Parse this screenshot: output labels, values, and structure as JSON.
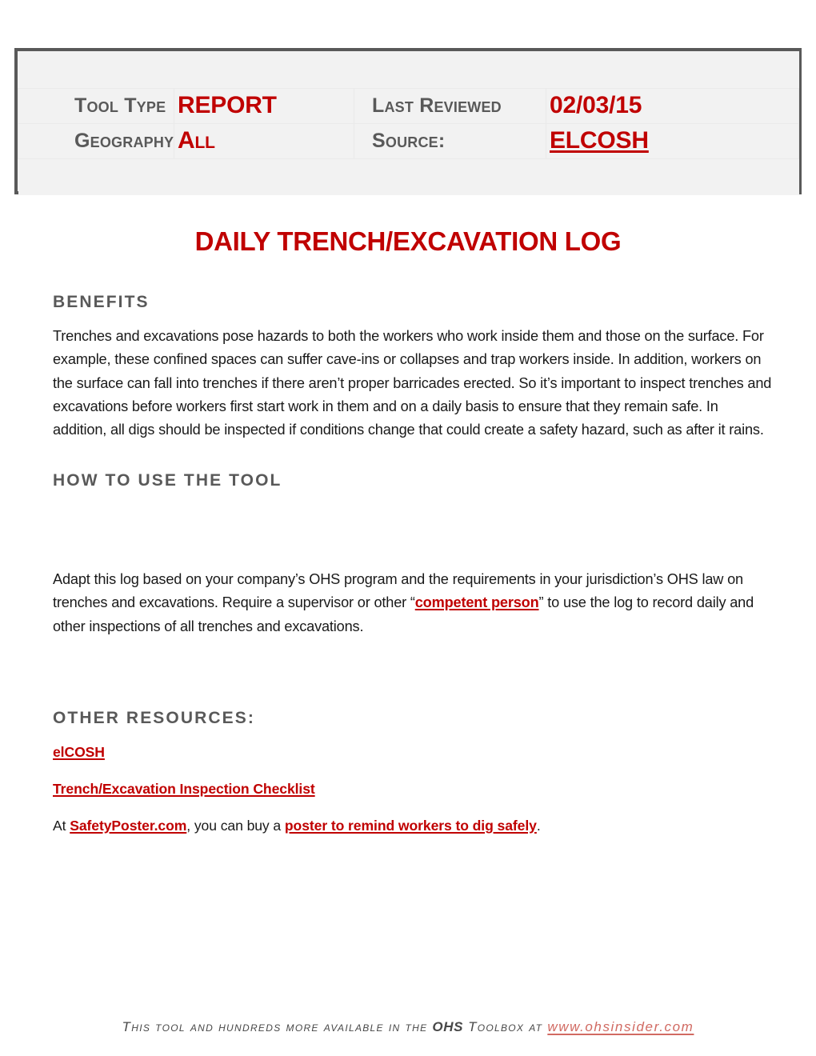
{
  "meta": {
    "rows": [
      {
        "label_left": "Tool Type",
        "value_left": "REPORT",
        "label_right": "Last Reviewed",
        "value_right": "02/03/15"
      },
      {
        "label_left": "Geography",
        "value_left": "All",
        "label_right": "Source:",
        "value_right": "ELCOSH"
      }
    ]
  },
  "title": "DAILY TRENCH/EXCAVATION LOG",
  "sections": {
    "benefits": {
      "heading": "BENEFITS",
      "body": "Trenches and excavations pose hazards to both the workers who work inside them and those on the surface. For example, these confined spaces can suffer cave-ins or collapses and trap workers inside. In addition, workers on the surface can fall into trenches if there aren’t proper barricades erected. So it’s important to inspect trenches and excavations before workers first start work in them and on a daily basis to ensure that they remain safe. In addition, all digs should be inspected if conditions change that could create a safety hazard, such as after it rains."
    },
    "how_to_use": {
      "heading": "HOW TO USE THE TOOL",
      "body_before_link": "Adapt this log based on your company’s OHS program and the requirements in your jurisdiction’s OHS law on trenches and excavations. Require a supervisor or other “",
      "link_text": "competent person",
      "body_after_link": "” to use the log to record daily  and other inspections of all trenches and excavations."
    },
    "other_resources": {
      "heading": "OTHER RESOURCES:",
      "link_elcosh": "elCOSH",
      "link_checklist": "Trench/Excavation Inspection Checklist",
      "poster_prefix": "At ",
      "poster_site": "SafetyPoster.com",
      "poster_middle": ", you can buy a ",
      "poster_link": "poster to remind workers to dig safely",
      "poster_suffix": "."
    }
  },
  "footer": {
    "text_before": "This tool and hundreds more available in the ",
    "ohs": "OHS",
    "text_middle": " Toolbox at ",
    "url": "www.ohsinsider.com"
  },
  "colors": {
    "accent_red": "#C00000",
    "label_gray": "#595959",
    "box_fill": "#F2F2F2",
    "box_border": "#595959",
    "body_text": "#1A1A1A",
    "footer_url": "#D16A62"
  }
}
